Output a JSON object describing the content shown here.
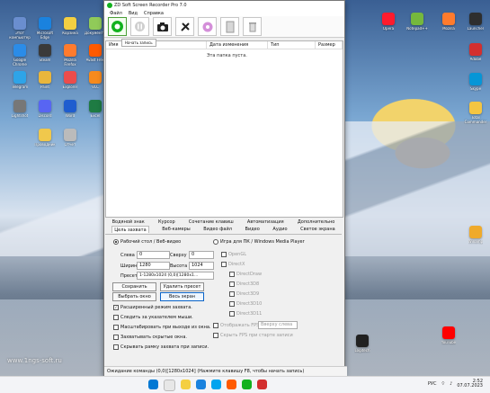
{
  "window": {
    "title": "ZD Soft Screen Recorder Pro 7.0",
    "menu": [
      "Файл",
      "Вид",
      "Справка"
    ],
    "tooltip": "Начать запись",
    "columns": [
      "Имя",
      "Дата изменения",
      "Тип",
      "Размер"
    ],
    "empty_text": "Эта папка пуста.",
    "tabs_row1": [
      "Водяной знак",
      "Курсор",
      "Сочетание клавиш",
      "Автоматизация",
      "Дополнительно"
    ],
    "tabs_row2": [
      "Цель захвата",
      "Веб-камеры",
      "Видео файл",
      "Видео",
      "Аудио",
      "Светое экрана"
    ],
    "left_options": {
      "mode": "Рабочий стол / Веб-видео",
      "left_label": "Слева",
      "left_value": "0",
      "top_label": "Сверху",
      "top_value": "0",
      "width_label": "Ширина",
      "width_value": "1280",
      "height_label": "Высота",
      "height_value": "1024",
      "preset_label": "Пресет",
      "preset_value": "1-1280x1024 (0,0)[1280x1...",
      "save_preset": "Сохранить пресет",
      "delete_preset": "Удалить пресет",
      "select_window": "Выбрать окно",
      "full_screen": "Весь экран",
      "extended_mode": "Расширенный режим захвата.",
      "follow_mouse": "Следить за указателем мыши.",
      "auto_scale": "Масштабировать при выходе из окна.",
      "hidden_window": "Захватывать скрытые окна.",
      "hide_frame": "Скрывать рамку захвата при записи."
    },
    "right_options": {
      "mode": "Игра для ПК / Windows Media Player",
      "opengl": "OpenGL",
      "directx": "DirectX",
      "draw": "DirectDraw",
      "d3d8": "Direct3D8",
      "d3d9": "Direct3D9",
      "d3d10": "Direct3D10",
      "d3d11": "Direct3D11",
      "fps": "Отображать FPS",
      "fps_position": "Вверху слева",
      "hide_fps": "Скрыть FPS при старте записи"
    },
    "status": "Ожидание команды (0,0)[1280x1024] (Нажмите клавишу F8, чтобы начать запись)"
  },
  "desktop": {
    "icons": [
      [
        "Этот компьютер"
      ],
      [
        "Microsoft Edge"
      ],
      [
        "Корзина"
      ],
      [
        "Документы"
      ],
      [
        "Google Chrome"
      ],
      [
        "Steam"
      ],
      [
        "Mozilla Firefox"
      ],
      [
        "Avast Free"
      ],
      [
        "Telegram"
      ],
      [
        "Paint"
      ],
      [
        "Explorer"
      ],
      [
        "VLC"
      ],
      [
        "Lightshot"
      ],
      [
        "Discord"
      ],
      [
        "Word"
      ],
      [
        "Excel"
      ],
      [
        "Проводник"
      ],
      [
        "Отчёт"
      ]
    ],
    "right_icons": [
      "Opera",
      "Notepad++",
      "Mozilla",
      "Launcher",
      "Adobe",
      "Skype",
      "Total Commander",
      "Winamp",
      "YouTube",
      "Logitech"
    ],
    "watermark": "www.1ngs-soft.ru",
    "clock_time": "2:52",
    "clock_date": "07.07.2023",
    "lang": "РУС"
  },
  "colors": {
    "green": "#12b11e",
    "blue": "#0a63c7"
  }
}
